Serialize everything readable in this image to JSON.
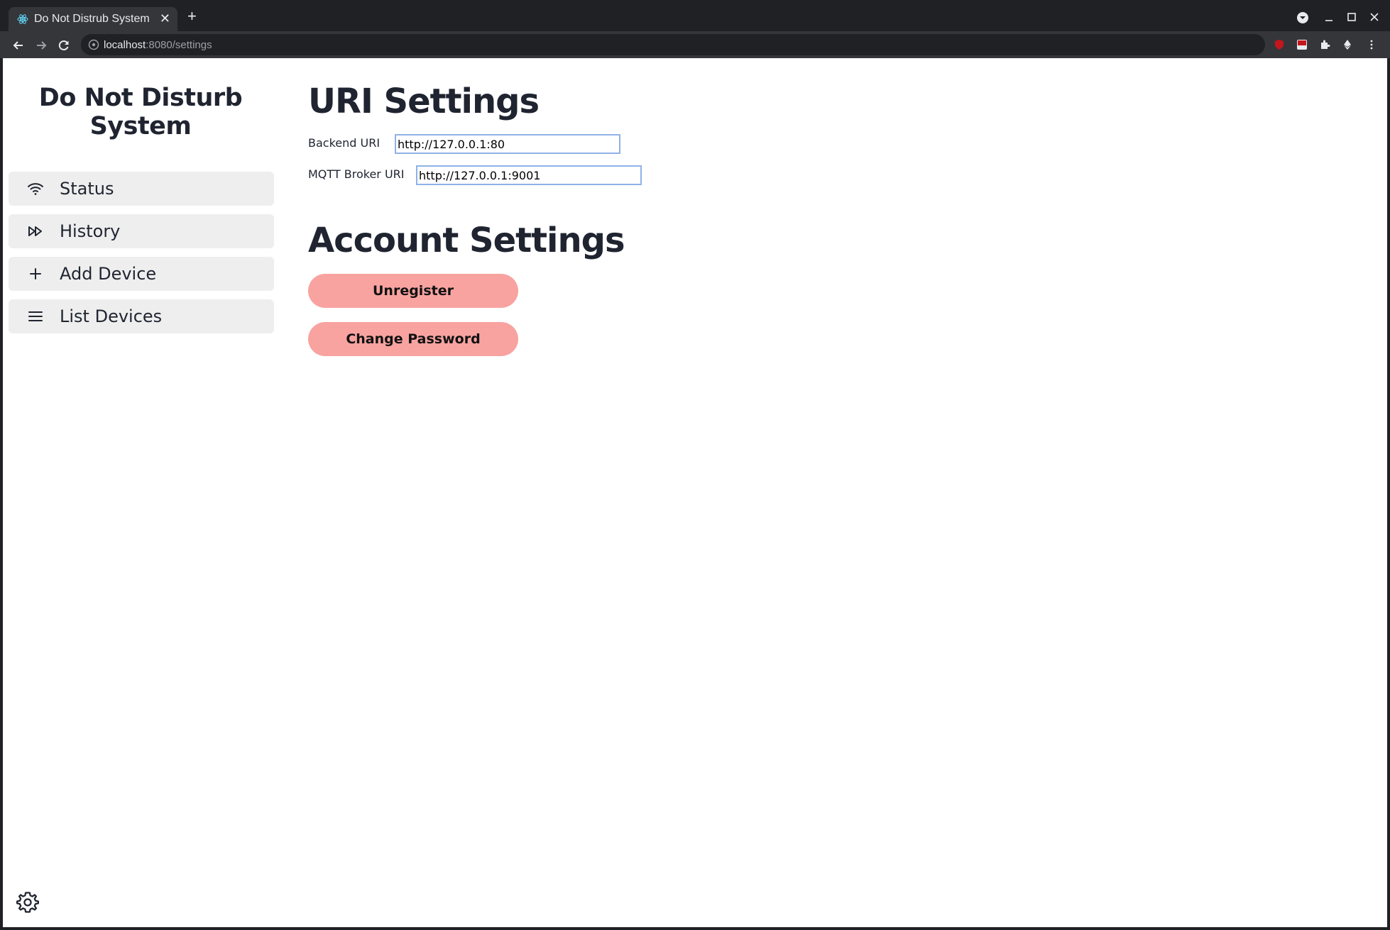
{
  "browser": {
    "tab_title": "Do Not Distrub System",
    "close_glyph": "✕",
    "newtab_glyph": "+",
    "url_host": "localhost",
    "url_path": ":8080/settings"
  },
  "sidebar": {
    "brand_line1": "Do Not Disturb",
    "brand_line2": "System",
    "items": [
      {
        "label": "Status",
        "icon": "wifi-icon"
      },
      {
        "label": "History",
        "icon": "fast-forward-icon"
      },
      {
        "label": "Add Device",
        "icon": "plus-icon"
      },
      {
        "label": "List Devices",
        "icon": "menu-icon"
      }
    ]
  },
  "uri_settings": {
    "heading": "URI Settings",
    "backend_label": "Backend URI",
    "backend_value": "http://127.0.0.1:80",
    "mqtt_label": "MQTT Broker URI",
    "mqtt_value": "http://127.0.0.1:9001"
  },
  "account_settings": {
    "heading": "Account Settings",
    "unregister_label": "Unregister",
    "change_password_label": "Change Password"
  },
  "colors": {
    "button_bg": "#f8a3a0",
    "nav_bg": "#eeeeee",
    "heading": "#1f2430"
  }
}
